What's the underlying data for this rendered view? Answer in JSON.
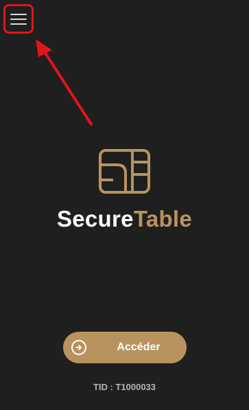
{
  "brand": {
    "name_part1": "Secure",
    "name_part2": "Table"
  },
  "access_button": {
    "label": "Accéder",
    "icon": "arrow-circle-right-icon"
  },
  "footer": {
    "tid": "TID : T1000033"
  },
  "menu": {
    "icon": "hamburger-menu-icon"
  },
  "annotation": {
    "highlight_color": "#e3141b"
  },
  "colors": {
    "background": "#1f1f1f",
    "accent_gold": "#b8935f",
    "text_white": "#ffffff",
    "tid_gray": "#b5b5b5"
  }
}
